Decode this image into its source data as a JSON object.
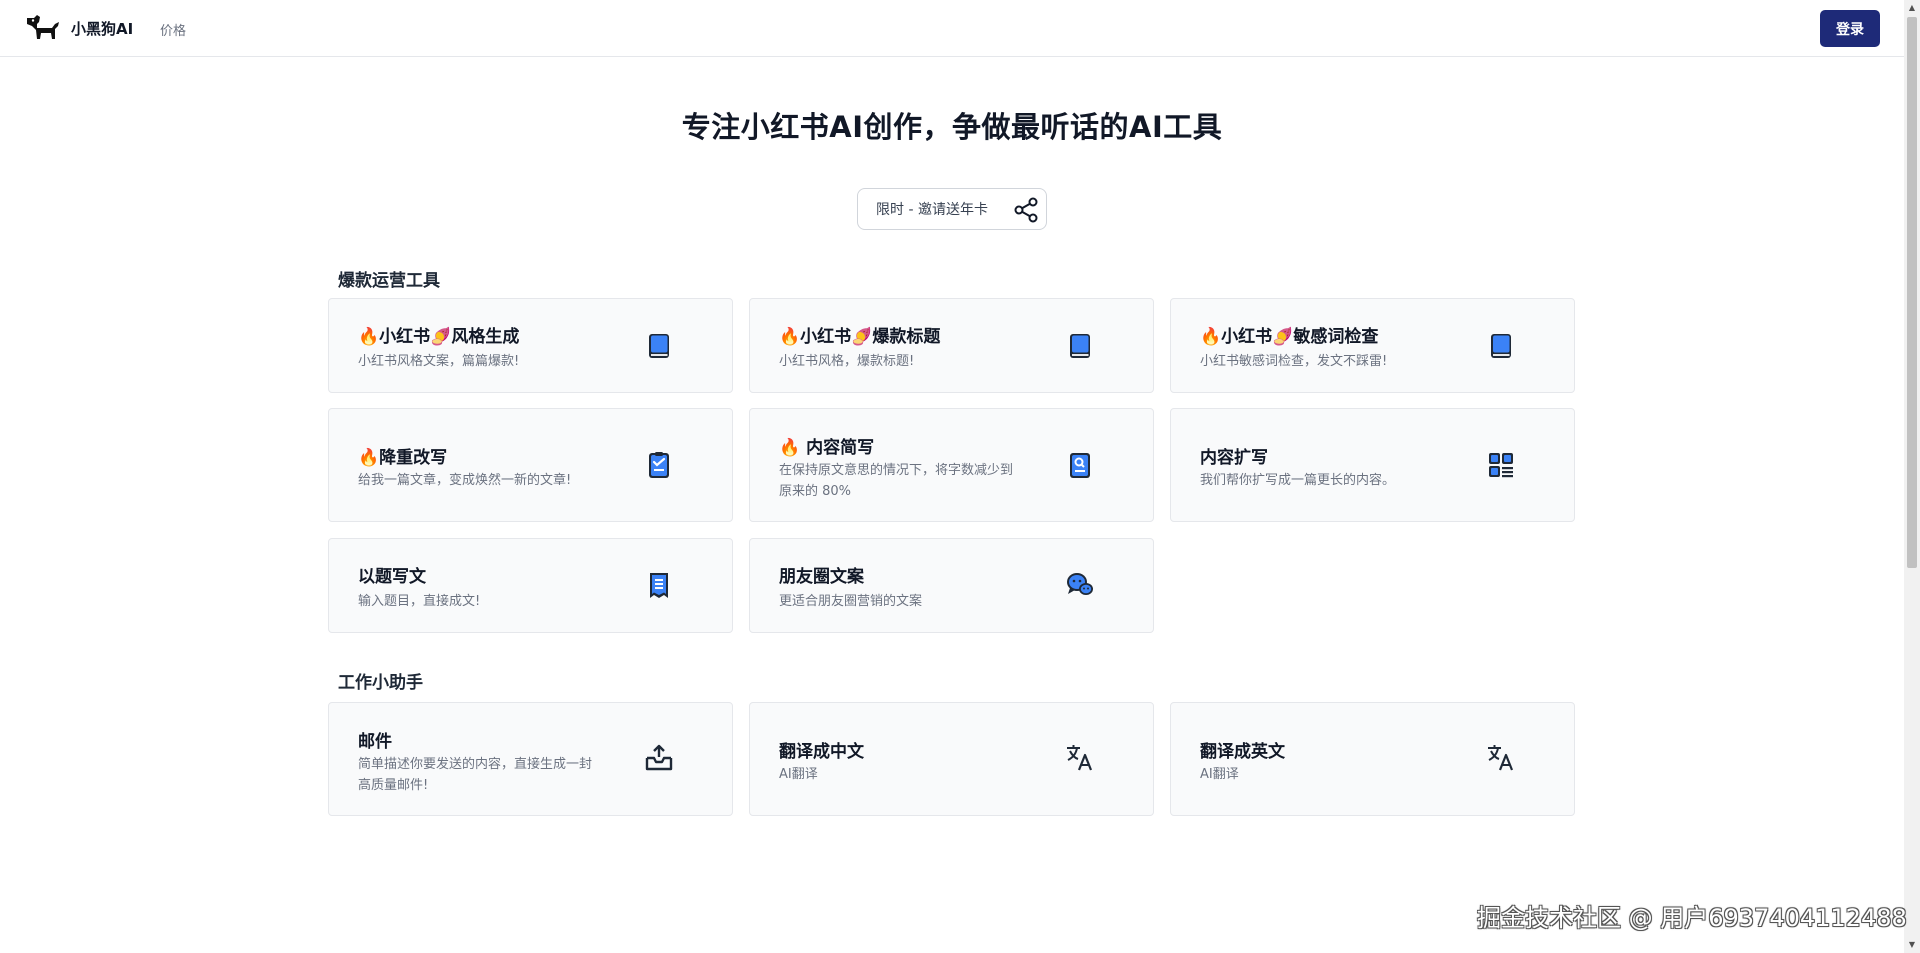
{
  "header": {
    "brand": "小黑狗AI",
    "nav_price": "价格",
    "login": "登录"
  },
  "hero": {
    "title": "专注小红书AI创作，争做最听话的AI工具",
    "invite_label": "限时 - 邀请送年卡"
  },
  "sections": [
    {
      "title": "爆款运营工具",
      "cards": [
        {
          "title": "🔥小红书🍠风格生成",
          "desc": "小红书风格文案，篇篇爆款!",
          "icon": "book-icon"
        },
        {
          "title": "🔥小红书🍠爆款标题",
          "desc": "小红书风格，爆款标题!",
          "icon": "book-icon"
        },
        {
          "title": "🔥小红书🍠敏感词检查",
          "desc": "小红书敏感词检查，发文不踩雷!",
          "icon": "book-icon"
        },
        {
          "title": "🔥降重改写",
          "desc": "给我一篇文章，变成焕然一新的文章!",
          "icon": "clipboard-check-icon"
        },
        {
          "title": "🔥 内容简写",
          "desc": "在保持原文意思的情况下，将字数减少到原来的 80%",
          "icon": "document-search-icon"
        },
        {
          "title": "内容扩写",
          "desc": "我们帮你扩写成一篇更长的内容。",
          "icon": "grid-list-icon"
        },
        {
          "title": "以题写文",
          "desc": "输入题目，直接成文!",
          "icon": "receipt-icon"
        },
        {
          "title": "朋友圈文案",
          "desc": "更适合朋友圈营销的文案",
          "icon": "chat-bubbles-icon"
        }
      ]
    },
    {
      "title": "工作小助手",
      "cards": [
        {
          "title": "邮件",
          "desc": "简单描述你要发送的内容，直接生成一封高质量邮件!",
          "icon": "inbox-upload-icon"
        },
        {
          "title": "翻译成中文",
          "desc": "AI翻译",
          "icon": "translate-icon"
        },
        {
          "title": "翻译成英文",
          "desc": "AI翻译",
          "icon": "translate-icon"
        }
      ]
    }
  ],
  "watermark": "掘金技术社区 @ 用户6937404112488",
  "colors": {
    "login_bg": "#1e2a78",
    "icon_blue": "#3b82f6",
    "icon_dark": "#1f2937",
    "card_bg": "#f9fafb",
    "border": "#e5e7eb"
  }
}
